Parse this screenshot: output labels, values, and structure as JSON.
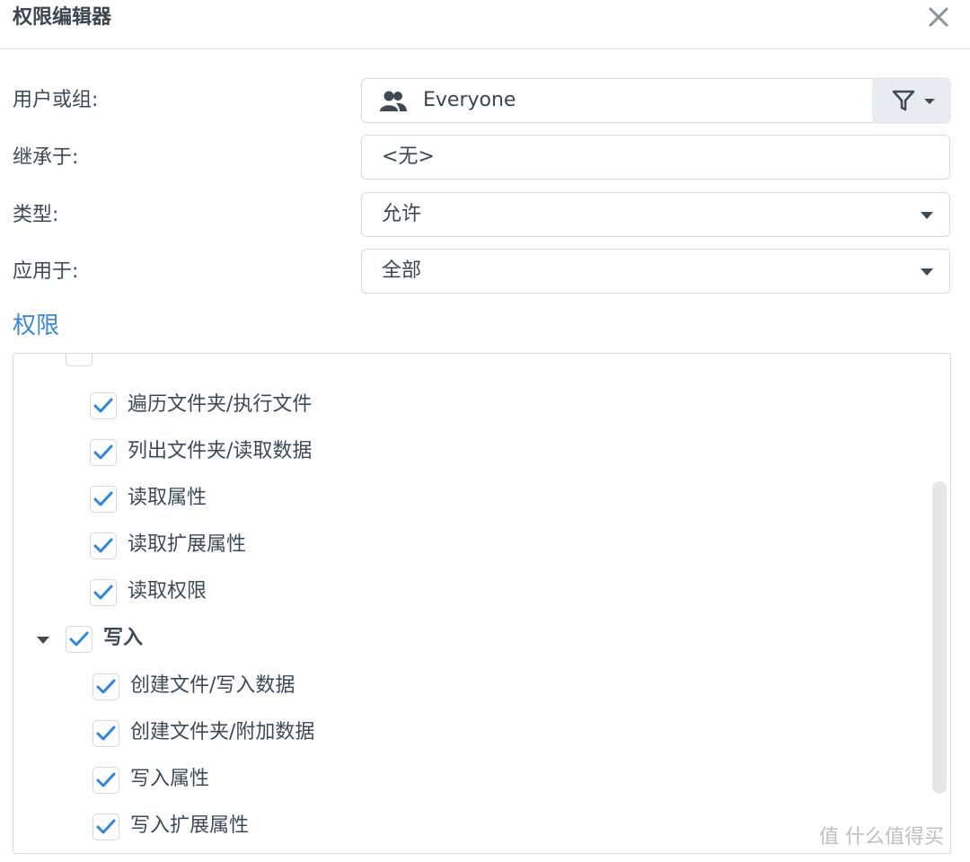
{
  "dialog": {
    "title": "权限编辑器"
  },
  "form": {
    "user_group_label": "用户或组:",
    "user_group_value": "Everyone",
    "inherit_label": "继承于:",
    "inherit_value": "<无>",
    "type_label": "类型:",
    "type_value": "允许",
    "apply_label": "应用于:",
    "apply_value": "全部"
  },
  "permissions": {
    "title": "权限",
    "read_items": [
      {
        "label": "遍历文件夹/执行文件",
        "checked": true
      },
      {
        "label": "列出文件夹/读取数据",
        "checked": true
      },
      {
        "label": "读取属性",
        "checked": true
      },
      {
        "label": "读取扩展属性",
        "checked": true
      },
      {
        "label": "读取权限",
        "checked": true
      }
    ],
    "write_group": {
      "label": "写入",
      "checked": true,
      "expanded": true
    },
    "write_items": [
      {
        "label": "创建文件/写入数据",
        "checked": true
      },
      {
        "label": "创建文件夹/附加数据",
        "checked": true
      },
      {
        "label": "写入属性",
        "checked": true
      },
      {
        "label": "写入扩展属性",
        "checked": true
      }
    ]
  },
  "watermark": "值 什么值得买",
  "colors": {
    "accent": "#3a8ad9",
    "check": "#2f86e0",
    "text": "#3c4a57"
  }
}
